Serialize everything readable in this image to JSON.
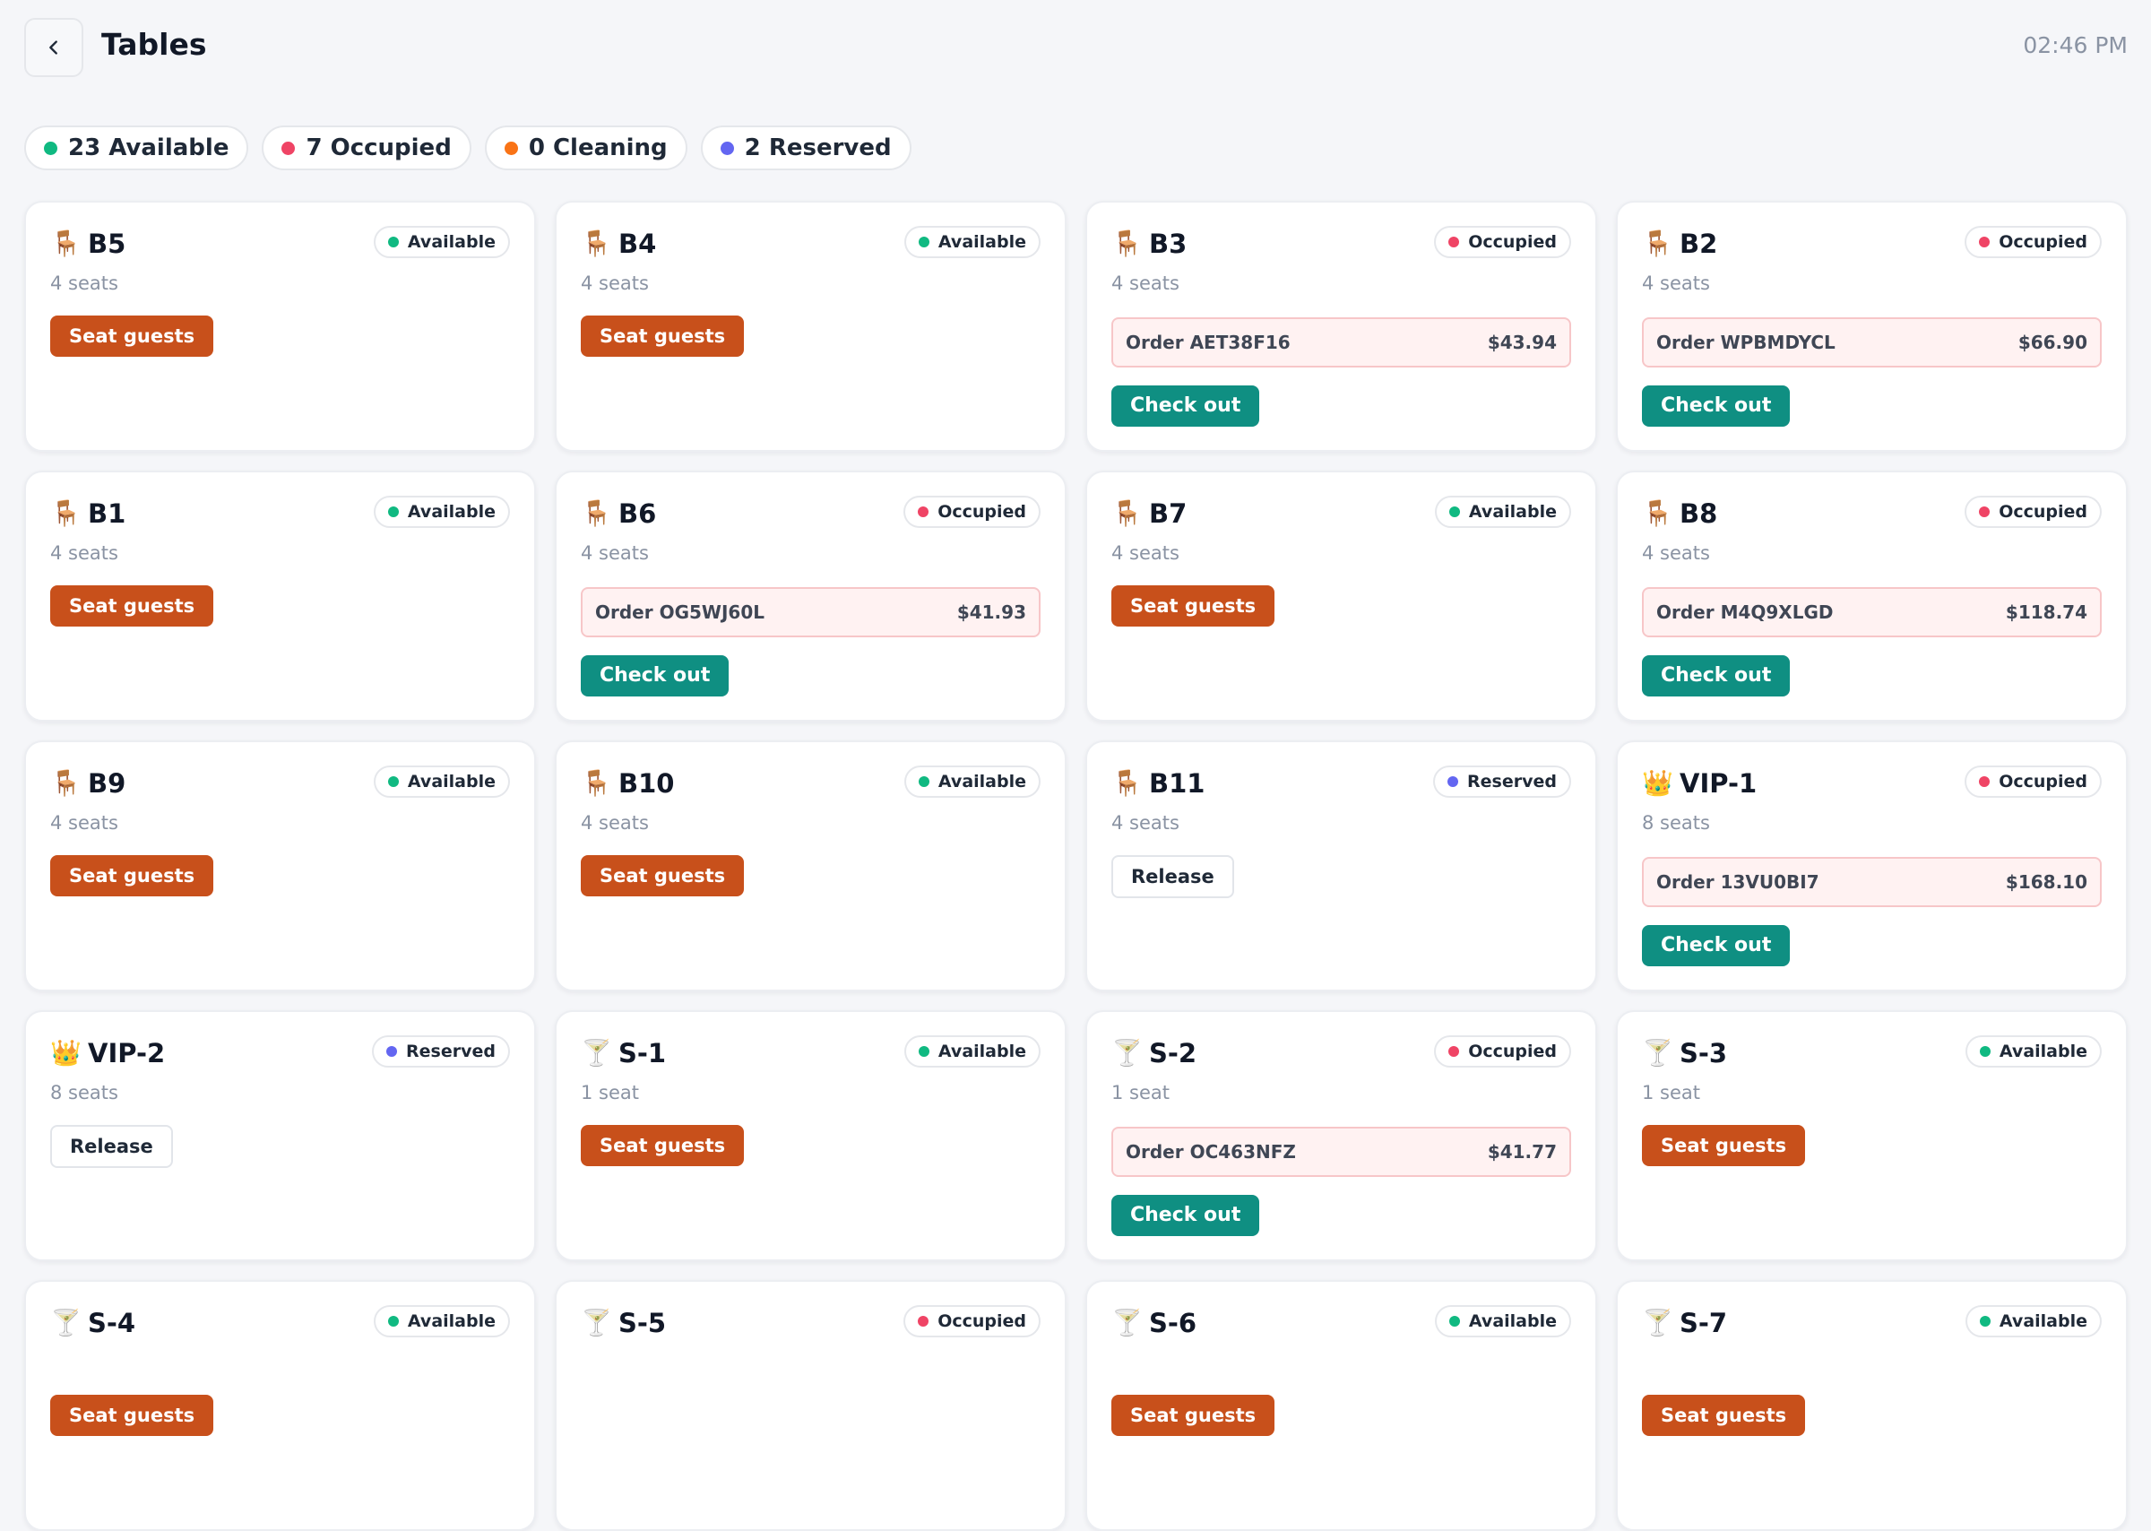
{
  "header": {
    "title": "Tables",
    "time": "02:46 PM"
  },
  "colors": {
    "available": "#10b981",
    "occupied": "#ef4465",
    "cleaning": "#f97316",
    "reserved": "#6366f1",
    "seat_button": "#c8501b",
    "checkout_button": "#0f8f82"
  },
  "summary": [
    {
      "label": "23 Available",
      "status": "available"
    },
    {
      "label": "7 Occupied",
      "status": "occupied"
    },
    {
      "label": "0 Cleaning",
      "status": "cleaning"
    },
    {
      "label": "2 Reserved",
      "status": "reserved"
    }
  ],
  "actions": {
    "seat": "Seat guests",
    "checkout": "Check out",
    "release": "Release"
  },
  "tables": [
    {
      "name": "B5",
      "icon": "chair-icon",
      "glyph": "🪑",
      "seats": "4 seats",
      "status": "available",
      "status_label": "Available"
    },
    {
      "name": "B4",
      "icon": "chair-icon",
      "glyph": "🪑",
      "seats": "4 seats",
      "status": "available",
      "status_label": "Available"
    },
    {
      "name": "B3",
      "icon": "chair-icon",
      "glyph": "🪑",
      "seats": "4 seats",
      "status": "occupied",
      "status_label": "Occupied",
      "order": "Order AET38F16",
      "amount": "$43.94"
    },
    {
      "name": "B2",
      "icon": "chair-icon",
      "glyph": "🪑",
      "seats": "4 seats",
      "status": "occupied",
      "status_label": "Occupied",
      "order": "Order WPBMDYCL",
      "amount": "$66.90"
    },
    {
      "name": "B1",
      "icon": "chair-icon",
      "glyph": "🪑",
      "seats": "4 seats",
      "status": "available",
      "status_label": "Available"
    },
    {
      "name": "B6",
      "icon": "chair-icon",
      "glyph": "🪑",
      "seats": "4 seats",
      "status": "occupied",
      "status_label": "Occupied",
      "order": "Order OG5WJ60L",
      "amount": "$41.93"
    },
    {
      "name": "B7",
      "icon": "chair-icon",
      "glyph": "🪑",
      "seats": "4 seats",
      "status": "available",
      "status_label": "Available"
    },
    {
      "name": "B8",
      "icon": "chair-icon",
      "glyph": "🪑",
      "seats": "4 seats",
      "status": "occupied",
      "status_label": "Occupied",
      "order": "Order M4Q9XLGD",
      "amount": "$118.74"
    },
    {
      "name": "B9",
      "icon": "chair-icon",
      "glyph": "🪑",
      "seats": "4 seats",
      "status": "available",
      "status_label": "Available"
    },
    {
      "name": "B10",
      "icon": "chair-icon",
      "glyph": "🪑",
      "seats": "4 seats",
      "status": "available",
      "status_label": "Available"
    },
    {
      "name": "B11",
      "icon": "chair-icon",
      "glyph": "🪑",
      "seats": "4 seats",
      "status": "reserved",
      "status_label": "Reserved"
    },
    {
      "name": "VIP-1",
      "icon": "crown-icon",
      "glyph": "👑",
      "seats": "8 seats",
      "status": "occupied",
      "status_label": "Occupied",
      "order": "Order 13VU0BI7",
      "amount": "$168.10"
    },
    {
      "name": "VIP-2",
      "icon": "crown-icon",
      "glyph": "👑",
      "seats": "8 seats",
      "status": "reserved",
      "status_label": "Reserved"
    },
    {
      "name": "S-1",
      "icon": "cocktail-icon",
      "glyph": "🍸",
      "seats": "1 seat",
      "status": "available",
      "status_label": "Available"
    },
    {
      "name": "S-2",
      "icon": "cocktail-icon",
      "glyph": "🍸",
      "seats": "1 seat",
      "status": "occupied",
      "status_label": "Occupied",
      "order": "Order OC463NFZ",
      "amount": "$41.77"
    },
    {
      "name": "S-3",
      "icon": "cocktail-icon",
      "glyph": "🍸",
      "seats": "1 seat",
      "status": "available",
      "status_label": "Available"
    },
    {
      "name": "S-4",
      "icon": "cocktail-icon",
      "glyph": "🍸",
      "seats": "",
      "status": "available",
      "status_label": "Available"
    },
    {
      "name": "S-5",
      "icon": "cocktail-icon",
      "glyph": "🍸",
      "seats": "",
      "status": "occupied",
      "status_label": "Occupied"
    },
    {
      "name": "S-6",
      "icon": "cocktail-icon",
      "glyph": "🍸",
      "seats": "",
      "status": "available",
      "status_label": "Available"
    },
    {
      "name": "S-7",
      "icon": "cocktail-icon",
      "glyph": "🍸",
      "seats": "",
      "status": "available",
      "status_label": "Available"
    }
  ]
}
